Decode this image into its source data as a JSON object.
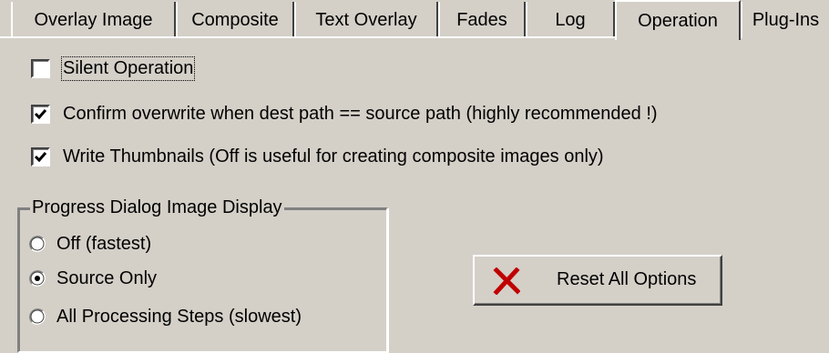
{
  "tabs": [
    {
      "label": "Overlay Image",
      "active": false
    },
    {
      "label": "Composite",
      "active": false
    },
    {
      "label": "Text Overlay",
      "active": false
    },
    {
      "label": "Fades",
      "active": false
    },
    {
      "label": "Log",
      "active": false
    },
    {
      "label": "Operation",
      "active": true
    },
    {
      "label": "Plug-Ins",
      "active": false
    }
  ],
  "options": {
    "silent_operation": {
      "label": "Silent Operation",
      "checked": false
    },
    "confirm_overwrite": {
      "label": "Confirm overwrite when dest path == source path (highly recommended !)",
      "checked": true
    },
    "write_thumbnails": {
      "label": "Write Thumbnails (Off is useful for creating composite images only)",
      "checked": true
    }
  },
  "progress_display": {
    "title": "Progress Dialog Image Display",
    "choices": [
      {
        "label": "Off (fastest)",
        "selected": false
      },
      {
        "label": "Source Only",
        "selected": true
      },
      {
        "label": "All Processing Steps (slowest)",
        "selected": false
      }
    ]
  },
  "reset_button": {
    "label": "Reset All Options",
    "icon": "red-x-icon",
    "icon_color": "#c00000"
  }
}
